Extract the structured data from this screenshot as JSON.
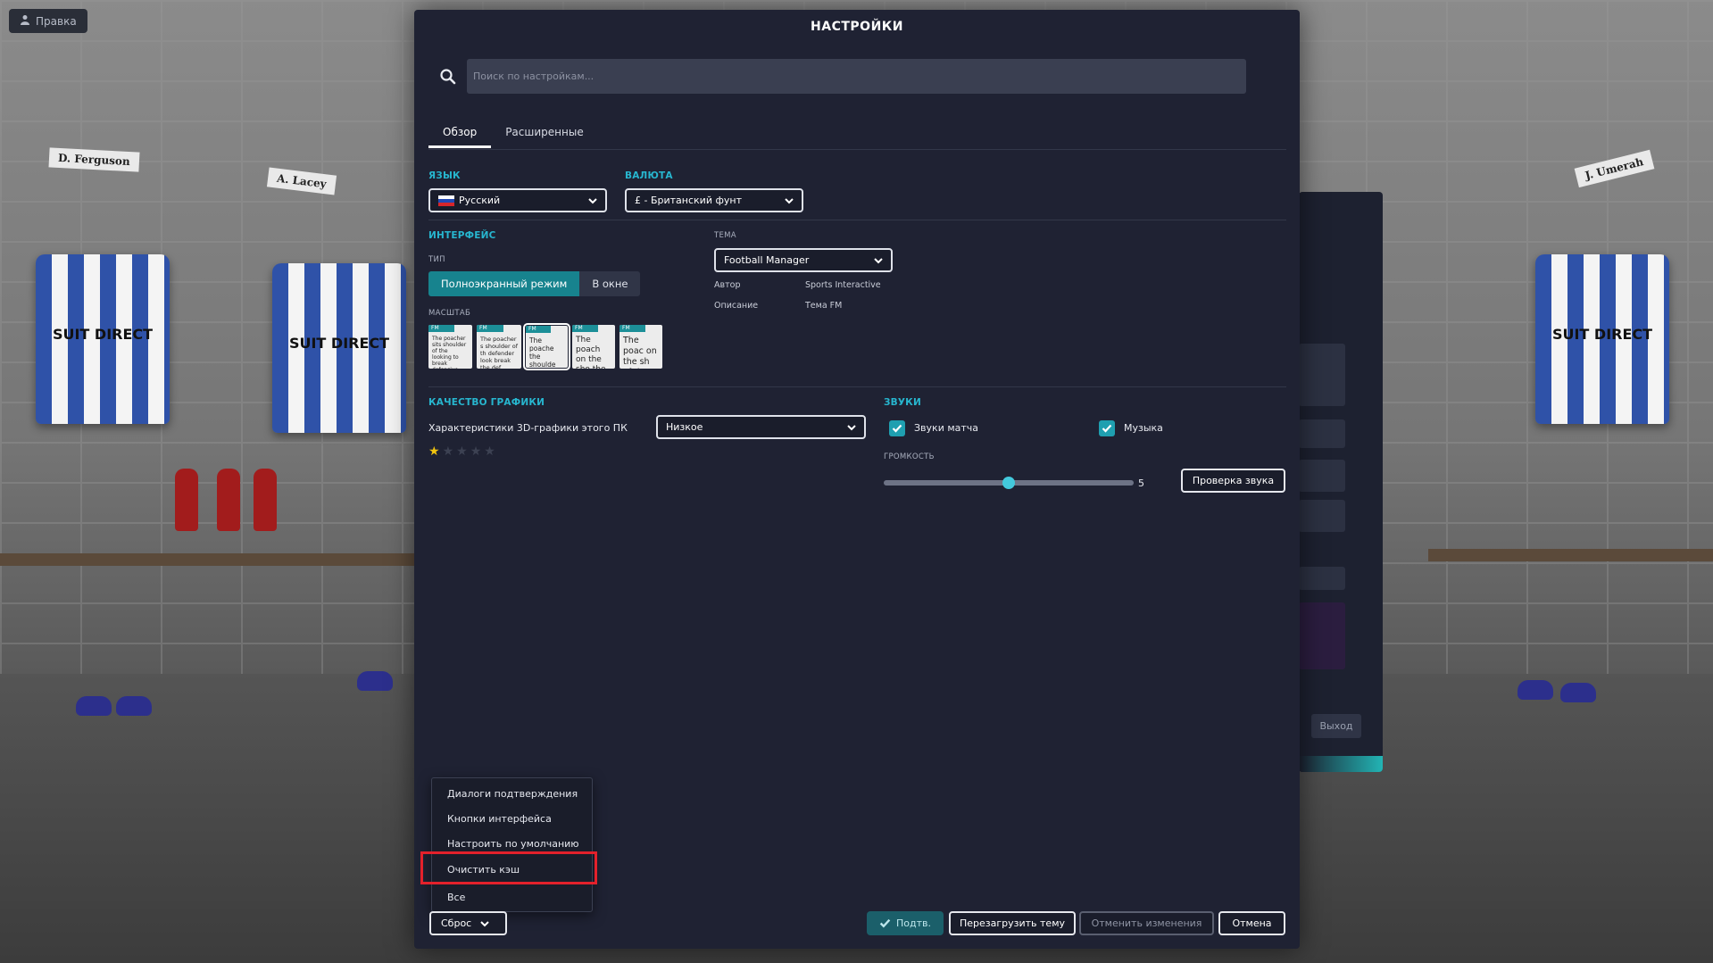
{
  "top_left": {
    "label": "Правка",
    "icon": "person-icon"
  },
  "background_panel": {
    "exit_label": "Выход"
  },
  "dialog": {
    "title": "НАСТРОЙКИ",
    "search": {
      "placeholder": "Поиск по настройкам...",
      "value": ""
    },
    "tabs": [
      {
        "label": "Обзор",
        "active": true
      },
      {
        "label": "Расширенные",
        "active": false
      }
    ],
    "language": {
      "section": "ЯЗЫК",
      "value": "Русский"
    },
    "currency": {
      "section": "ВАЛЮТА",
      "value": "£ - Британский фунт"
    },
    "interface": {
      "section": "ИНТЕРФЕЙС",
      "type_label": "ТИП",
      "modes": [
        {
          "label": "Полноэкранный режим",
          "selected": true
        },
        {
          "label": "В окне",
          "selected": false
        }
      ],
      "scale_label": "МАСШТАБ",
      "scale_previews": [
        {
          "header": "FM",
          "text": "The poacher sits shoulder of the looking to break defensive line a",
          "selected": false
        },
        {
          "header": "FM",
          "text": "The poacher s shoulder of th defender look break the def",
          "selected": false
        },
        {
          "header": "FM",
          "text": "The poache the shoulde last defend",
          "selected": true
        },
        {
          "header": "FM",
          "text": "The poach on the sho the last de",
          "selected": false
        },
        {
          "header": "FM",
          "text": "The poac on the sh of the las",
          "selected": false
        }
      ]
    },
    "theme": {
      "label": "ТЕМА",
      "value": "Football Manager",
      "author_label": "Автор",
      "author_value": "Sports Interactive",
      "description_label": "Описание",
      "description_value": "Тема FM"
    },
    "graphics": {
      "section": "КАЧЕСТВО ГРАФИКИ",
      "pc_label": "Характеристики 3D-графики этого ПК",
      "quality_value": "Низкое",
      "rating": 1,
      "rating_max": 5
    },
    "sounds": {
      "section": "ЗВУКИ",
      "match_sounds_label": "Звуки матча",
      "match_sounds_checked": true,
      "music_label": "Музыка",
      "music_checked": true,
      "volume_label": "ГРОМКОСТЬ",
      "volume_value": "5",
      "volume_fraction": 0.5,
      "test_button": "Проверка звука"
    },
    "reset_menu": {
      "items": [
        "Диалоги подтверждения",
        "Кнопки интерфейса",
        "Настроить по умолчанию",
        "Очистить кэш",
        "Все"
      ],
      "highlighted_index": 3
    },
    "footer": {
      "reset_label": "Сброс",
      "confirm_label": "Подтв.",
      "reload_theme_label": "Перезагрузить тему",
      "undo_label": "Отменить изменения",
      "cancel_label": "Отмена"
    }
  },
  "scene": {
    "nameplates": [
      "D. Ferguson",
      "A. Lacey",
      "J. Umerah"
    ],
    "sponsor": "SUIT DIRECT"
  }
}
